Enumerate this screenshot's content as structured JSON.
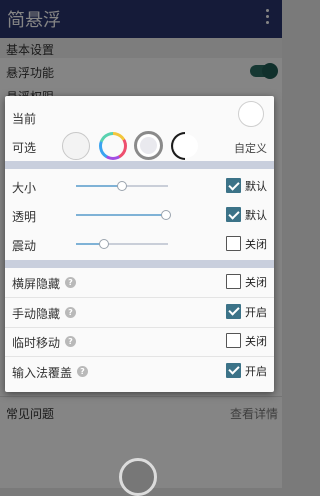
{
  "app": {
    "title": "简悬浮"
  },
  "background": {
    "section_basic": "基本设置",
    "float_function": "悬浮功能",
    "partial_item": "悬浮权限",
    "faq": "常见问题",
    "faq_link": "查看详情"
  },
  "dialog": {
    "current_label": "当前",
    "optional_label": "可选",
    "custom_link": "自定义",
    "sliders": [
      {
        "label": "大小",
        "value": 0.5,
        "checked": true,
        "check_label": "默认"
      },
      {
        "label": "透明",
        "value": 0.98,
        "checked": true,
        "check_label": "默认"
      },
      {
        "label": "震动",
        "value": 0.3,
        "checked": false,
        "check_label": "关闭"
      }
    ],
    "options": [
      {
        "label": "横屏隐藏",
        "help": "?",
        "checked": false,
        "check_label": "关闭"
      },
      {
        "label": "手动隐藏",
        "help": "?",
        "checked": true,
        "check_label": "开启"
      },
      {
        "label": "临时移动",
        "help": "?",
        "checked": false,
        "check_label": "关闭"
      },
      {
        "label": "输入法覆盖",
        "help": "?",
        "checked": true,
        "check_label": "开启"
      }
    ]
  },
  "colors": {
    "appbar": "#2a356e",
    "checkbox_on": "#3c7388",
    "separator": "#c9cfdd"
  }
}
